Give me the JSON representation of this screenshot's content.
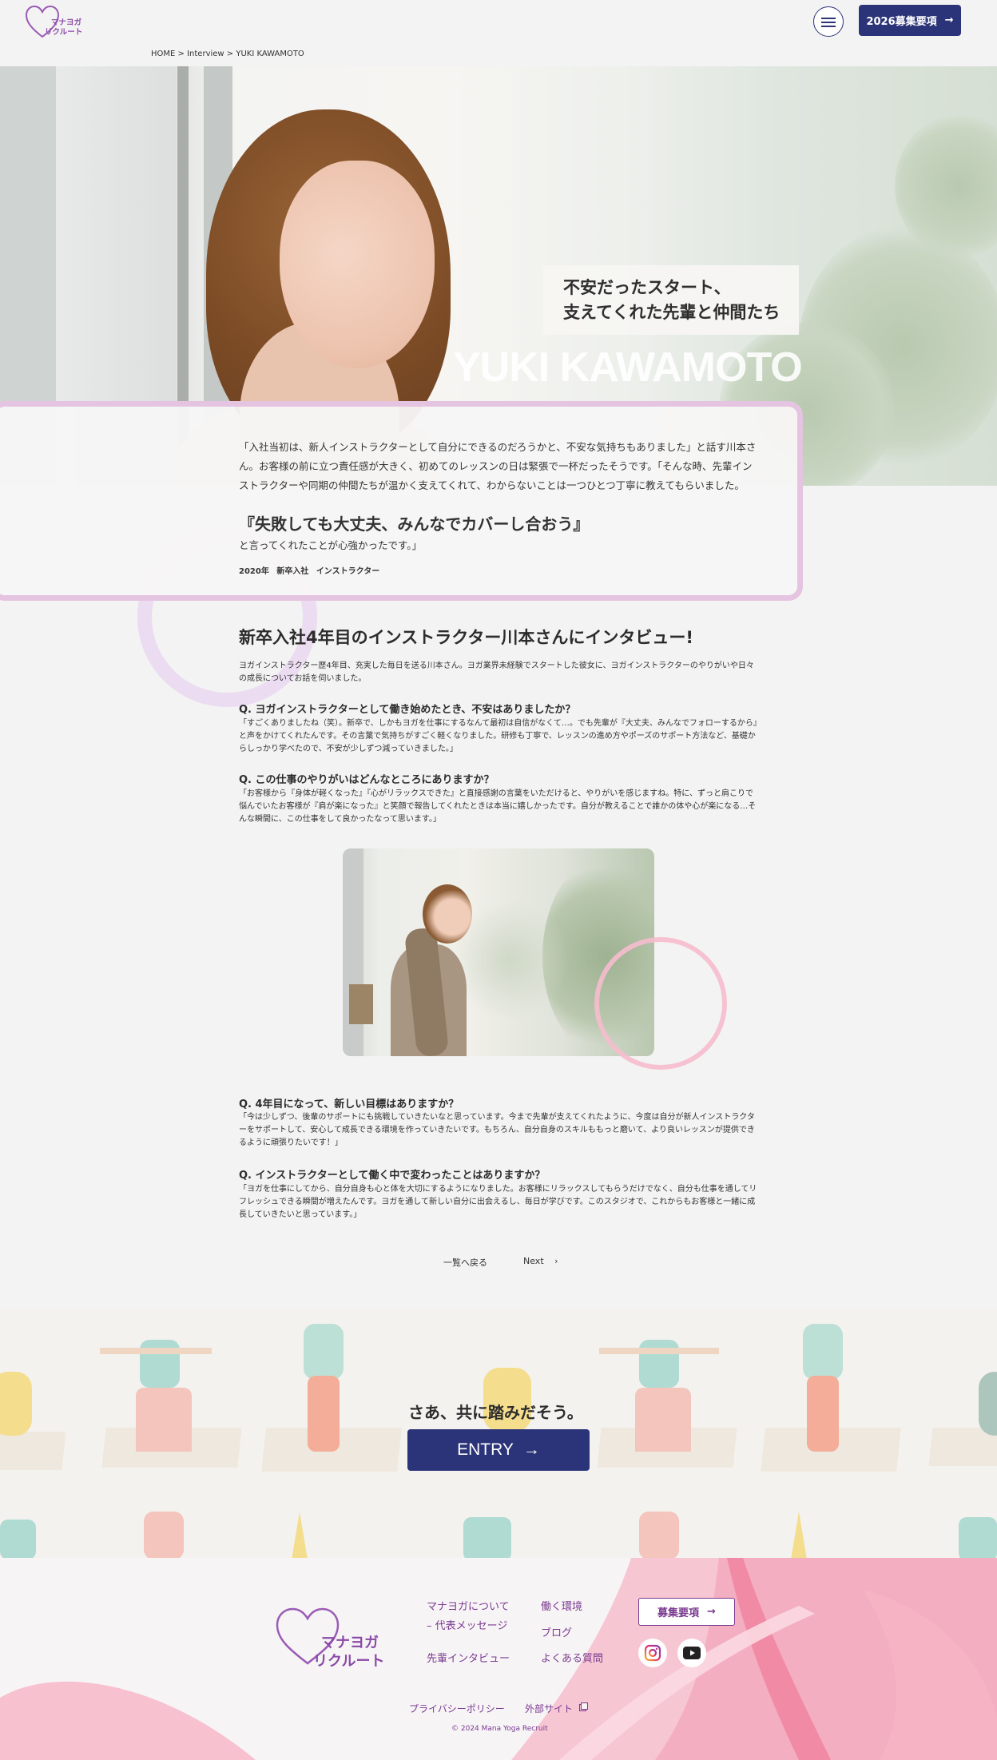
{
  "header": {
    "logo_text_1": "マナヨガ",
    "logo_text_2": "リクルート",
    "recruit_year": "2026",
    "recruit_label": "募集要項",
    "arrow": "→"
  },
  "breadcrumb": {
    "home": "HOME",
    "sep": " > ",
    "interview": "Interview",
    "current": "YUKI KAWAMOTO"
  },
  "hero": {
    "catch_line1": "不安だったスタート、",
    "catch_line2": "支えてくれた先輩と仲間たち",
    "name": "YUKI KAWAMOTO"
  },
  "quote": {
    "intro": "「入社当初は、新人インストラクターとして自分にできるのだろうかと、不安な気持ちもありました」と話す川本さん。お客様の前に立つ責任感が大きく、初めてのレッスンの日は緊張で一杯だったそうです。「そんな時、先輩インストラクターや同期の仲間たちが温かく支えてくれて、わからないことは一つひとつ丁寧に教えてもらいました。",
    "highlight": "『失敗しても大丈夫、みんなでカバーし合おう』",
    "ending": "と言ってくれたことが心強かったです。」",
    "join_year": "2020年",
    "join_type": "新卒入社",
    "role": "インストラクター"
  },
  "article": {
    "title": "新卒入社4年目のインストラクター川本さんにインタビュー!",
    "lead": "ヨガインストラクター歴4年目、充実した毎日を送る川本さん。ヨガ業界未経験でスタートした彼女に、ヨガインストラクターのやりがいや日々の成長についてお話を伺いました。",
    "qa": [
      {
        "q": "Q. ヨガインストラクターとして働き始めたとき、不安はありましたか？",
        "a": "「すごくありましたね（笑）。新卒で、しかもヨガを仕事にするなんて最初は自信がなくて…。でも先輩が『大丈夫、みんなでフォローするから』と声をかけてくれたんです。その言葉で気持ちがすごく軽くなりました。研修も丁寧で、レッスンの進め方やポーズのサポート方法など、基礎からしっかり学べたので、不安が少しずつ減っていきました。」"
      },
      {
        "q": "Q. この仕事のやりがいはどんなところにありますか？",
        "a": "「お客様から『身体が軽くなった』『心がリラックスできた』と直接感謝の言葉をいただけると、やりがいを感じますね。特に、ずっと肩こりで悩んでいたお客様が『肩が楽になった』と笑顔で報告してくれたときは本当に嬉しかったです。自分が教えることで誰かの体や心が楽になる…そんな瞬間に、この仕事をして良かったなって思います。」"
      },
      {
        "q": "Q. 4年目になって、新しい目標はありますか？",
        "a": "「今は少しずつ、後輩のサポートにも挑戦していきたいなと思っています。今まで先輩が支えてくれたように、今度は自分が新人インストラクターをサポートして、安心して成長できる環境を作っていきたいです。もちろん、自分自身のスキルももっと磨いて、より良いレッスンが提供できるように頑張りたいです！」"
      },
      {
        "q": "Q. インストラクターとして働く中で変わったことはありますか？",
        "a": "「ヨガを仕事にしてから、自分自身も心と体を大切にするようになりました。お客様にリラックスしてもらうだけでなく、自分も仕事を通してリフレッシュできる瞬間が増えたんです。ヨガを通して新しい自分に出会えるし、毎日が学びです。このスタジオで、これからもお客様と一緒に成長していきたいと思っています。」"
      }
    ]
  },
  "pager": {
    "back": "一覧へ戻る",
    "next": "Next",
    "next_icon": "›"
  },
  "entry": {
    "title": "さあ、共に踏みだそう。",
    "button": "ENTRY",
    "arrow": "→"
  },
  "footer": {
    "logo_text_1": "マナヨガ",
    "logo_text_2": "リクルート",
    "links": {
      "about": "マナヨガについて",
      "message": "– 代表メッセージ",
      "interview": "先輩インタビュー",
      "environment": "働く環境",
      "blog": "ブログ",
      "faq": "よくある質問"
    },
    "recruit_button": "募集要項",
    "arrow": "→",
    "privacy": "プライバシーポリシー",
    "external": "外部サイト",
    "copyright": "© 2024 Mana Yoga Recruit"
  },
  "icons": {
    "instagram": "instagram-icon",
    "youtube": "youtube-icon",
    "menu": "hamburger-icon",
    "external": "external-link-icon"
  },
  "colors": {
    "navy": "#2b3478",
    "purple": "#7a3a8f",
    "pink": "#f3a3bd",
    "lavender": "#e4c4e0"
  }
}
